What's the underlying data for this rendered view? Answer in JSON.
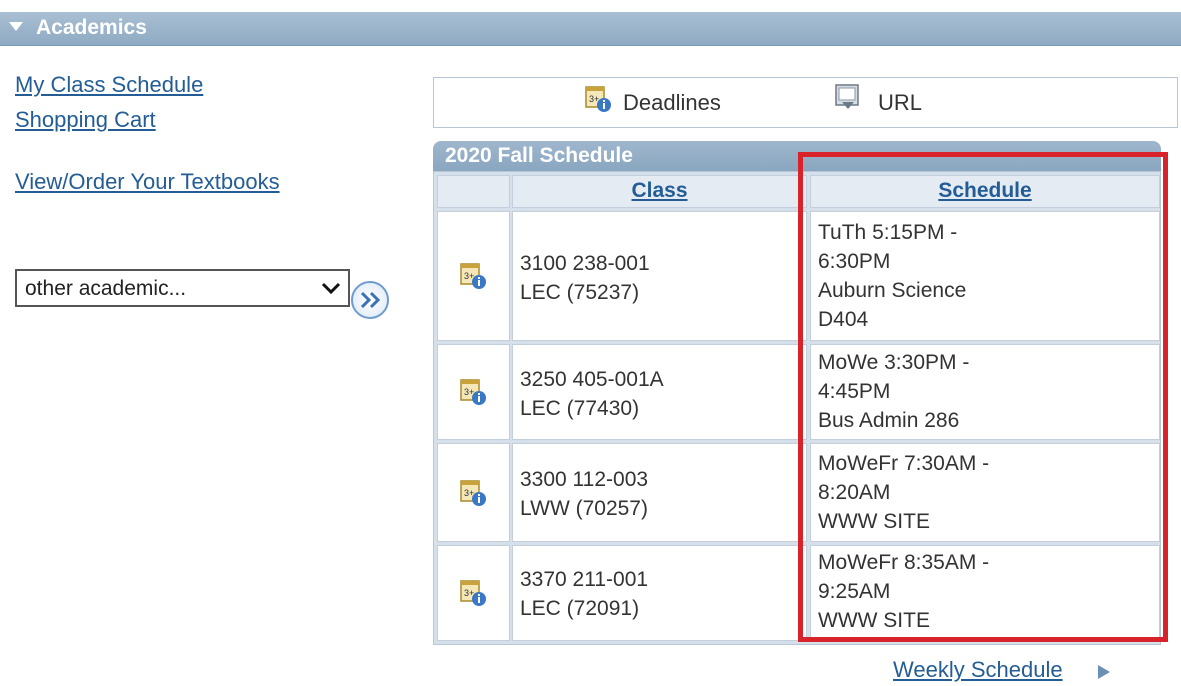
{
  "header": {
    "title": "Academics"
  },
  "left_links": {
    "my_class_schedule": "My Class Schedule",
    "shopping_cart": "Shopping Cart",
    "textbooks": "View/Order Your Textbooks"
  },
  "dropdown": {
    "selected": "other academic..."
  },
  "toolbar": {
    "deadlines_label": "Deadlines",
    "url_label": "URL"
  },
  "schedule": {
    "title": "2020 Fall Schedule",
    "columns": {
      "class": "Class",
      "schedule": "Schedule"
    },
    "rows": [
      {
        "class_line1": "3100 238-001",
        "class_line2": "LEC (75237)",
        "sched_line1": "TuTh 5:15PM -",
        "sched_line2": "6:30PM",
        "sched_line3": "Auburn Science",
        "sched_line4": "D404"
      },
      {
        "class_line1": "3250 405-001A",
        "class_line2": "LEC (77430)",
        "sched_line1": "MoWe 3:30PM -",
        "sched_line2": "4:45PM",
        "sched_line3": "Bus Admin 286",
        "sched_line4": ""
      },
      {
        "class_line1": "3300 112-003",
        "class_line2": "LWW (70257)",
        "sched_line1": "MoWeFr 7:30AM -",
        "sched_line2": "8:20AM",
        "sched_line3": "WWW SITE",
        "sched_line4": ""
      },
      {
        "class_line1": "3370 211-001",
        "class_line2": "LEC (72091)",
        "sched_line1": "MoWeFr 8:35AM -",
        "sched_line2": "9:25AM",
        "sched_line3": "WWW SITE",
        "sched_line4": ""
      }
    ]
  },
  "weekly_schedule_label": "Weekly Schedule",
  "colors": {
    "link": "#245d96",
    "header_bar": "#9bb4cb",
    "highlight": "#d9232b"
  }
}
